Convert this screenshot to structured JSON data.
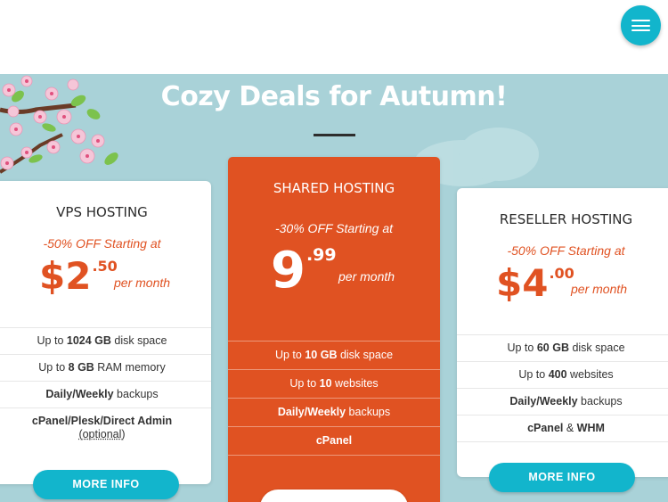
{
  "header": {
    "menu_icon": "hamburger-menu-icon",
    "accent": "#12b5cc"
  },
  "hero": {
    "title": "Cozy Deals for Autumn!",
    "bg_color": "#a9d2d8"
  },
  "plans": [
    {
      "id": "vps",
      "title": "VPS HOSTING",
      "offer": "-50% OFF Starting at",
      "currency": "$",
      "price_main": "2",
      "price_cents": ".50",
      "period": "per month",
      "features": [
        {
          "pre": "Up to ",
          "bold": "1024 GB",
          "post": " disk space"
        },
        {
          "pre": "Up to ",
          "bold": "8 GB",
          "post": " RAM memory"
        },
        {
          "pre": "",
          "bold": "Daily/Weekly",
          "post": " backups"
        },
        {
          "pre": "",
          "bold": "cPanel/Plesk/Direct Admin",
          "post": "",
          "note": "(optional)"
        }
      ],
      "button": "MORE INFO"
    },
    {
      "id": "shared",
      "title": "SHARED HOSTING",
      "offer": "-30% OFF Starting at",
      "currency": "",
      "price_main": "9",
      "price_cents": ".99",
      "period": "per month",
      "features": [
        {
          "pre": "Up to ",
          "bold": "10 GB",
          "post": " disk space"
        },
        {
          "pre": "Up to ",
          "bold": "10",
          "post": " websites"
        },
        {
          "pre": "",
          "bold": "Daily/Weekly",
          "post": " backups"
        },
        {
          "pre": "",
          "bold": "cPanel",
          "post": ""
        }
      ],
      "button": ""
    },
    {
      "id": "reseller",
      "title": "RESELLER HOSTING",
      "offer": "-50% OFF Starting at",
      "currency": "$",
      "price_main": "4",
      "price_cents": ".00",
      "period": "per month",
      "features": [
        {
          "pre": "Up to ",
          "bold": "60 GB",
          "post": " disk space"
        },
        {
          "pre": "Up to ",
          "bold": "400",
          "post": " websites"
        },
        {
          "pre": "",
          "bold": "Daily/Weekly",
          "post": " backups"
        },
        {
          "pre": "",
          "bold": "cPanel",
          "post": " & ",
          "bold2": "WHM"
        }
      ],
      "button": "MORE INFO"
    }
  ],
  "colors": {
    "orange": "#e05222",
    "cyan": "#12b5cc",
    "text": "#2b2b2b"
  }
}
